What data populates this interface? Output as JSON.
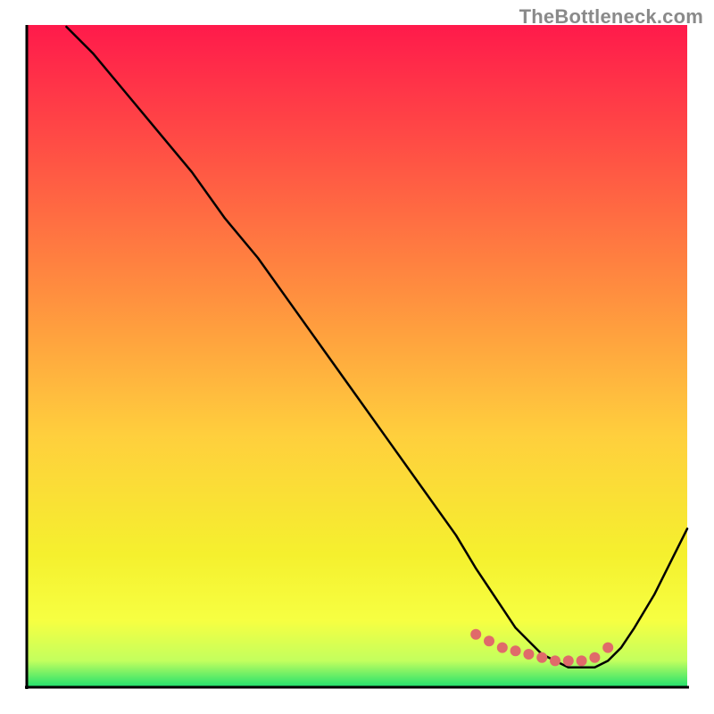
{
  "watermark": {
    "text": "TheBottleneck.com"
  },
  "colors": {
    "gradient_stops": [
      {
        "offset": 0.0,
        "color": "#ff1a4b"
      },
      {
        "offset": 0.18,
        "color": "#ff4d45"
      },
      {
        "offset": 0.4,
        "color": "#ff8d3f"
      },
      {
        "offset": 0.62,
        "color": "#ffcf3d"
      },
      {
        "offset": 0.8,
        "color": "#f5f02e"
      },
      {
        "offset": 0.9,
        "color": "#f6ff42"
      },
      {
        "offset": 0.96,
        "color": "#c3ff5e"
      },
      {
        "offset": 1.0,
        "color": "#1fe06e"
      }
    ],
    "axis": "#000000",
    "curve": "#000000",
    "marker": "#e06a6a"
  },
  "chart_data": {
    "type": "line",
    "title": "",
    "xlabel": "",
    "ylabel": "",
    "xlim": [
      0,
      100
    ],
    "ylim": [
      0,
      100
    ],
    "series": [
      {
        "name": "bottleneck-curve",
        "x": [
          6,
          10,
          15,
          20,
          25,
          30,
          35,
          40,
          45,
          50,
          55,
          60,
          65,
          68,
          70,
          72,
          74,
          76,
          78,
          80,
          82,
          84,
          86,
          88,
          90,
          92,
          95,
          100
        ],
        "y": [
          100,
          96,
          90,
          84,
          78,
          71,
          65,
          58,
          51,
          44,
          37,
          30,
          23,
          18,
          15,
          12,
          9,
          7,
          5,
          4,
          3,
          3,
          3,
          4,
          6,
          9,
          14,
          24
        ]
      }
    ],
    "markers": {
      "name": "optimal-range",
      "x": [
        68,
        70,
        72,
        74,
        76,
        78,
        80,
        82,
        84,
        86,
        88
      ],
      "y": [
        8,
        7,
        6,
        5.5,
        5,
        4.5,
        4,
        4,
        4,
        4.5,
        6
      ]
    }
  }
}
